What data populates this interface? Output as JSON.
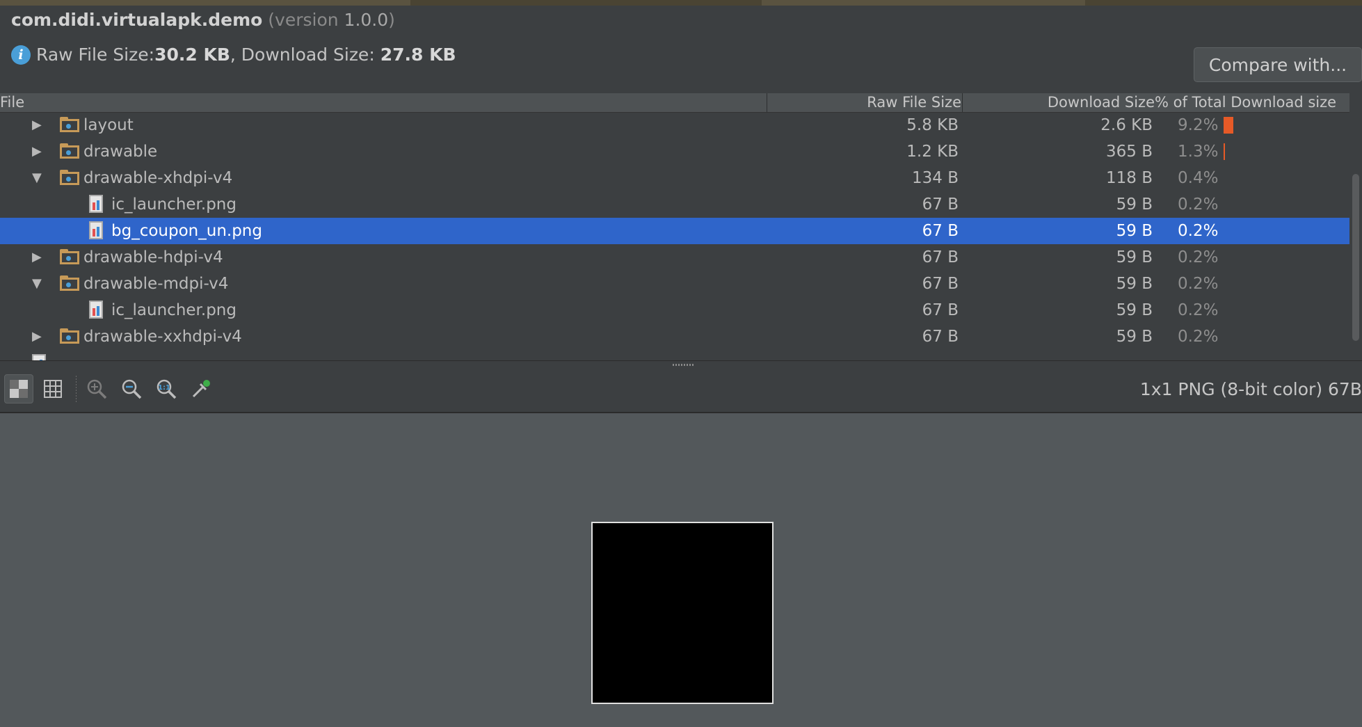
{
  "header": {
    "package": "com.didi.virtualapk.demo",
    "version_prefix": "(version ",
    "version": "1.0.0",
    "version_suffix": ")",
    "raw_label": "Raw File Size: ",
    "raw_value": "30.2 KB",
    "dl_label": ", Download Size: ",
    "dl_value": "27.8 KB",
    "compare_label": "Compare with..."
  },
  "table": {
    "columns": [
      "File",
      "Raw File Size",
      "Download Size",
      "% of Total Download size"
    ],
    "rows": [
      {
        "name": "layout",
        "type": "folder",
        "arrow": "▶",
        "raw": "5.8 KB",
        "dl": "2.6 KB",
        "pct": "9.2%",
        "bar_fraction": 0.092
      },
      {
        "name": "drawable",
        "type": "folder",
        "arrow": "▶",
        "raw": "1.2 KB",
        "dl": "365 B",
        "pct": "1.3%",
        "bar_fraction": 0.013
      },
      {
        "name": "drawable-xhdpi-v4",
        "type": "folder",
        "arrow": "▼",
        "raw": "134 B",
        "dl": "118 B",
        "pct": "0.4%",
        "bar_fraction": 0
      },
      {
        "name": "ic_launcher.png",
        "type": "file",
        "arrow": "",
        "raw": "67 B",
        "dl": "59 B",
        "pct": "0.2%",
        "bar_fraction": 0
      },
      {
        "name": "bg_coupon_un.png",
        "type": "file",
        "arrow": "",
        "raw": "67 B",
        "dl": "59 B",
        "pct": "0.2%",
        "bar_fraction": 0,
        "selected": true
      },
      {
        "name": "drawable-hdpi-v4",
        "type": "folder",
        "arrow": "▶",
        "raw": "67 B",
        "dl": "59 B",
        "pct": "0.2%",
        "bar_fraction": 0
      },
      {
        "name": "drawable-mdpi-v4",
        "type": "folder",
        "arrow": "▼",
        "raw": "67 B",
        "dl": "59 B",
        "pct": "0.2%",
        "bar_fraction": 0
      },
      {
        "name": "ic_launcher.png",
        "type": "file",
        "arrow": "",
        "raw": "67 B",
        "dl": "59 B",
        "pct": "0.2%",
        "bar_fraction": 0
      },
      {
        "name": "drawable-xxhdpi-v4",
        "type": "folder",
        "arrow": "▶",
        "raw": "67 B",
        "dl": "59 B",
        "pct": "0.2%",
        "bar_fraction": 0
      }
    ]
  },
  "toolbar": {
    "icons": [
      "transparency-chessboard-icon",
      "grid-icon",
      "zoom-in-icon",
      "zoom-out-icon",
      "actual-size-icon",
      "color-picker-icon"
    ],
    "image_info": "1x1 PNG (8-bit color) 67B"
  },
  "colors": {
    "background": "#3c3f41",
    "selection": "#2f65ca",
    "bar": "#e65a27",
    "preview_bg": "#53585b"
  }
}
